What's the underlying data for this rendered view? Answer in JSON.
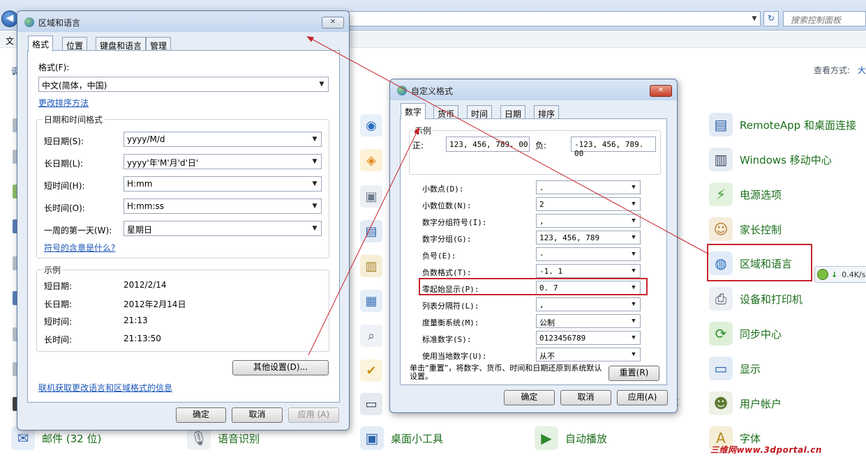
{
  "control_panel": {
    "search_placeholder": "搜索控制面板",
    "menu_file": "文",
    "adjust_text": "调",
    "view_by_label": "查看方式:",
    "view_by_value": "大",
    "middle_column": [
      {
        "label": "桌面小工具",
        "icon": "gadgets-icon"
      },
      {
        "label": "自动播放",
        "icon": "autoplay-icon"
      }
    ],
    "right_column": [
      {
        "label": "RemoteApp 和桌面连接",
        "icon": "remoteapp-icon"
      },
      {
        "label": "Windows 移动中心",
        "icon": "mobility-center-icon"
      },
      {
        "label": "电源选项",
        "icon": "power-options-icon"
      },
      {
        "label": "家长控制",
        "icon": "parental-controls-icon"
      },
      {
        "label": "区域和语言",
        "icon": "region-language-icon"
      },
      {
        "label": "设备和打印机",
        "icon": "devices-printers-icon"
      },
      {
        "label": "同步中心",
        "icon": "sync-center-icon"
      },
      {
        "label": "显示",
        "icon": "display-icon"
      },
      {
        "label": "用户帐户",
        "icon": "user-accounts-icon"
      },
      {
        "label": "字体",
        "icon": "fonts-icon"
      }
    ],
    "bottom_left": [
      {
        "label": "邮件 (32 位)",
        "icon": "mail-icon"
      },
      {
        "label": "语音识别",
        "icon": "speech-recognition-icon"
      }
    ],
    "speed_widget": "0.4K/s",
    "watermark": "三维网www.3dportal.cn"
  },
  "region_dialog": {
    "title": "区域和语言",
    "close": "✕",
    "tabs": [
      "格式",
      "位置",
      "键盘和语言",
      "管理"
    ],
    "format_label": "格式(F):",
    "format_value": "中文(简体，中国)",
    "sort_link": "更改排序方法",
    "datetime_group": "日期和时间格式",
    "rows": [
      {
        "label": "短日期(S):",
        "value": "yyyy/M/d"
      },
      {
        "label": "长日期(L):",
        "value": "yyyy'年'M'月'd'日'"
      },
      {
        "label": "短时间(H):",
        "value": "H:mm"
      },
      {
        "label": "长时间(O):",
        "value": "H:mm:ss"
      },
      {
        "label": "一周的第一天(W):",
        "value": "星期日"
      }
    ],
    "symbols_link": "符号的含意是什么?",
    "example_group": "示例",
    "examples": [
      {
        "label": "短日期:",
        "value": "2012/2/14"
      },
      {
        "label": "长日期:",
        "value": "2012年2月14日"
      },
      {
        "label": "短时间:",
        "value": "21:13"
      },
      {
        "label": "长时间:",
        "value": "21:13:50"
      }
    ],
    "other_settings": "其他设置(D)...",
    "online_link": "联机获取更改语言和区域格式的信息",
    "ok": "确定",
    "cancel": "取消",
    "apply": "应用 (A)"
  },
  "custom_dialog": {
    "title": "自定义格式",
    "close": "✕",
    "tabs": [
      "数字",
      "货币",
      "时间",
      "日期",
      "排序"
    ],
    "example_group": "示例",
    "positive_label": "正:",
    "positive_value": "123, 456, 789. 00",
    "negative_label": "负:",
    "negative_value": "-123, 456, 789. 00",
    "rows": [
      {
        "label": "小数点(D):",
        "value": "."
      },
      {
        "label": "小数位数(N):",
        "value": "2"
      },
      {
        "label": "数字分组符号(I):",
        "value": ","
      },
      {
        "label": "数字分组(G):",
        "value": "123, 456, 789"
      },
      {
        "label": "负号(E):",
        "value": "-"
      },
      {
        "label": "负数格式(T):",
        "value": "-1. 1"
      },
      {
        "label": "零起始显示(P):",
        "value": "0. 7"
      },
      {
        "label": "列表分隔符(L):",
        "value": ","
      },
      {
        "label": "度量衡系统(M):",
        "value": "公制"
      },
      {
        "label": "标准数字(S):",
        "value": "0123456789"
      },
      {
        "label": "使用当地数字(U):",
        "value": "从不"
      }
    ],
    "reset_note": "单击“重置”，将数字、货币、时间和日期还原到系统默认设置。",
    "reset": "重置(R)",
    "ok": "确定",
    "cancel": "取消",
    "apply": "应用(A)"
  },
  "colors": {
    "highlight": "#c8232c",
    "link": "#1a56b8",
    "cp_label": "#1c6f1c"
  }
}
